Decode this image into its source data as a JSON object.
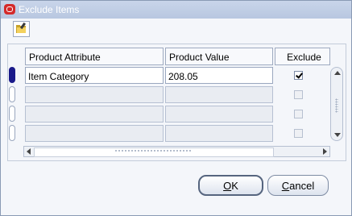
{
  "window": {
    "title": "Exclude Items",
    "close_icon": "oracle-close-icon"
  },
  "toolbar": {
    "folder_icon": "folder-edit-icon"
  },
  "table": {
    "columns": [
      "Product Attribute",
      "Product Value",
      "Exclude"
    ],
    "rows": [
      {
        "attribute": "Item Category",
        "value": "208.05",
        "exclude": true,
        "current": true
      },
      {
        "attribute": "",
        "value": "",
        "exclude": false,
        "current": false
      },
      {
        "attribute": "",
        "value": "",
        "exclude": false,
        "current": false
      },
      {
        "attribute": "",
        "value": "",
        "exclude": false,
        "current": false
      }
    ]
  },
  "buttons": {
    "ok": {
      "mnemonic": "O",
      "rest": "K"
    },
    "cancel": {
      "mnemonic": "C",
      "rest": "ancel"
    }
  }
}
